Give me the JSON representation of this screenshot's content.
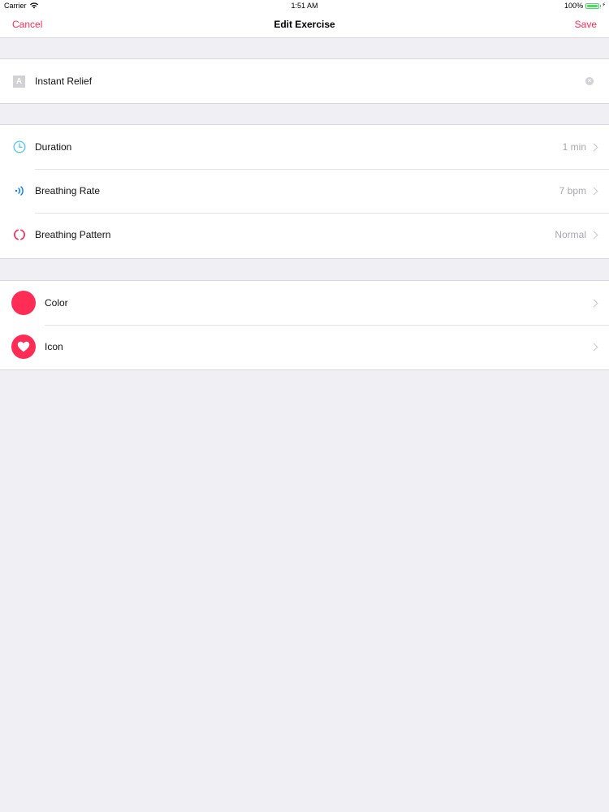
{
  "status_bar": {
    "carrier": "Carrier",
    "time": "1:51 AM",
    "battery": "100%"
  },
  "nav": {
    "cancel": "Cancel",
    "title": "Edit Exercise",
    "save": "Save"
  },
  "colors": {
    "accent": "#ff2d55",
    "duration_icon": "#5ac8fa",
    "rate_icon": "#007aff",
    "pattern_icon": "#ff2d55",
    "chosen_color": "#ff2d55"
  },
  "name_field": {
    "icon": "text-field-icon",
    "icon_letter": "A",
    "value": "Instant Relief"
  },
  "settings": [
    {
      "icon": "clock-icon",
      "label": "Duration",
      "value": "1 min"
    },
    {
      "icon": "breathing-rate-icon",
      "label": "Breathing Rate",
      "value": "7 bpm"
    },
    {
      "icon": "breathing-pattern-icon",
      "label": "Breathing Pattern",
      "value": "Normal"
    }
  ],
  "appearance": [
    {
      "icon": "color-swatch",
      "label": "Color"
    },
    {
      "icon": "heart-icon",
      "label": "Icon"
    }
  ]
}
